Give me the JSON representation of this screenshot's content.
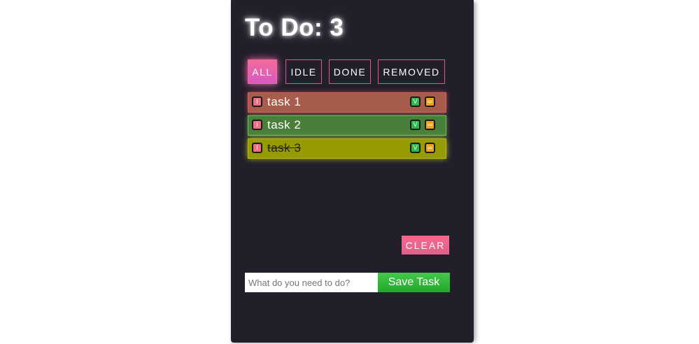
{
  "header": {
    "title": "To Do: 3"
  },
  "filters": [
    {
      "label": "ALL",
      "active": true
    },
    {
      "label": "IDLE",
      "active": false
    },
    {
      "label": "DONE",
      "active": false
    },
    {
      "label": "REMOVED",
      "active": false
    }
  ],
  "tasks": [
    {
      "label": "task 1",
      "status": "idle",
      "color": "#a85c4b"
    },
    {
      "label": "task 2",
      "status": "active",
      "color": "#4a7f3b"
    },
    {
      "label": "task 3",
      "status": "done",
      "color": "#969c00"
    }
  ],
  "task_buttons": {
    "idle_glyph": "I",
    "done_glyph": "V"
  },
  "clear_label": "CLEAR",
  "add_form": {
    "placeholder": "What do you need to do?",
    "value": "",
    "save_label": "Save Task"
  },
  "colors": {
    "panel_bg": "#211f2a",
    "accent_pink": "#f26b9a",
    "save_green": "#2db84b"
  }
}
